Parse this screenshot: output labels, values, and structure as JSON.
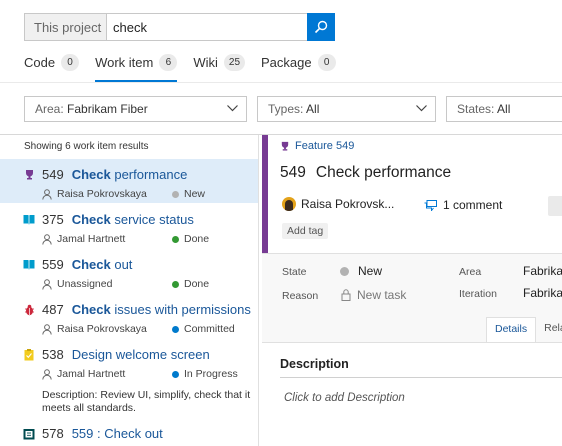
{
  "search": {
    "scope": "This project",
    "query": "check"
  },
  "tabs": [
    {
      "label": "Code",
      "count": "0"
    },
    {
      "label": "Work item",
      "count": "6"
    },
    {
      "label": "Wiki",
      "count": "25"
    },
    {
      "label": "Package",
      "count": "0"
    }
  ],
  "filters": {
    "area": {
      "label": "Area:",
      "value": "Fabrikam Fiber"
    },
    "types": {
      "label": "Types:",
      "value": "All"
    },
    "states": {
      "label": "States:",
      "value": "All"
    }
  },
  "results": {
    "summary": "Showing 6 work item results",
    "items": [
      {
        "id": "549",
        "match": "Check",
        "rest": " performance",
        "assignee": "Raisa Pokrovskaya",
        "state": "New",
        "state_color": "#b2b2b2",
        "type_icon": "trophy-icon",
        "icon_color": "#773b93"
      },
      {
        "id": "375",
        "match": "Check",
        "rest": " service status",
        "assignee": "Jamal Hartnett",
        "state": "Done",
        "state_color": "#339933",
        "type_icon": "book-icon",
        "icon_color": "#009ccc"
      },
      {
        "id": "559",
        "match": "Check",
        "rest": " out",
        "assignee": "Unassigned",
        "state": "Done",
        "state_color": "#339933",
        "type_icon": "book-icon",
        "icon_color": "#009ccc"
      },
      {
        "id": "487",
        "match": "Check",
        "rest": " issues with permissions",
        "assignee": "Raisa Pokrovskaya",
        "state": "Committed",
        "state_color": "#007acc",
        "type_icon": "bug-icon",
        "icon_color": "#cc293d"
      },
      {
        "id": "538",
        "match": "",
        "rest": "Design welcome screen",
        "assignee": "Jamal Hartnett",
        "state": "In Progress",
        "state_color": "#007acc",
        "type_icon": "task-icon",
        "icon_color": "#f2cb1d",
        "description": "Description: Review UI, simplify, check that it meets all standards."
      },
      {
        "id": "578",
        "match": "",
        "rest": "559 : Check out",
        "type_icon": "test-case-icon",
        "icon_color": "#004b50"
      }
    ]
  },
  "detail": {
    "type": "Feature 549",
    "id": "549",
    "title": "Check performance",
    "assignee": "Raisa Pokrovsk...",
    "comments": "1 comment",
    "add_tag": "Add tag",
    "state_label": "State",
    "state_value": "New",
    "reason_label": "Reason",
    "reason_value": "New task",
    "area_label": "Area",
    "area_value": "Fabrikam",
    "iteration_label": "Iteration",
    "iteration_value": "Fabrikam",
    "tab_details": "Details",
    "tab_related": "Rela",
    "description_heading": "Description",
    "description_placeholder": "Click to add Description"
  },
  "colors": {
    "accent": "#0078d4",
    "feature": "#773b93",
    "selected_row": "#deecf9",
    "link": "#1a5799"
  }
}
